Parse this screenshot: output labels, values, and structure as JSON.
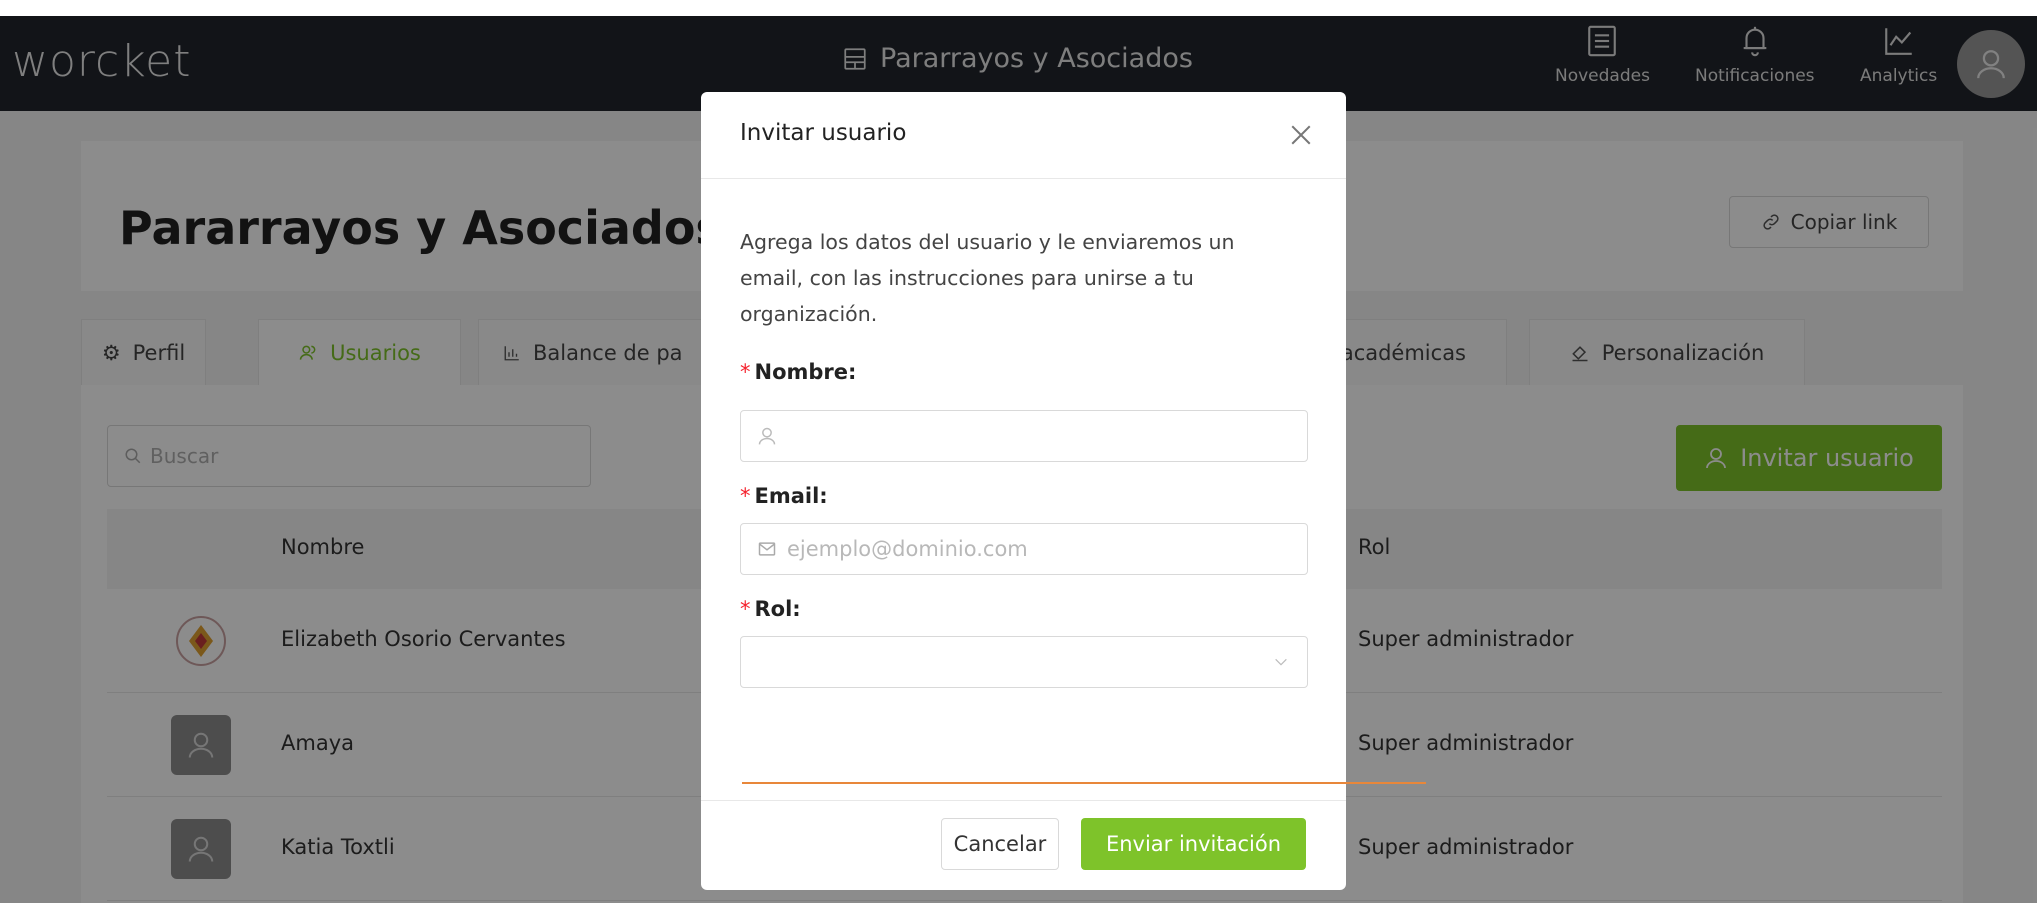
{
  "topbar": {
    "logo": "worcket",
    "org_name": "Pararrayos y Asociados",
    "items": [
      {
        "label": "Novedades",
        "icon": "list-icon"
      },
      {
        "label": "Notificaciones",
        "icon": "bell-icon"
      },
      {
        "label": "Analytics",
        "icon": "chart-line-icon"
      }
    ],
    "avatar_icon": "user-icon"
  },
  "header": {
    "title": "Pararrayos y Asociados",
    "copy_link_label": "Copiar link"
  },
  "tabs": [
    {
      "label": "Perfil",
      "icon": "gear-icon"
    },
    {
      "label": "Usuarios",
      "icon": "users-icon",
      "active": true
    },
    {
      "label": "Balance de pa",
      "icon": "bar-chart-icon"
    },
    {
      "label": "s académicas",
      "icon": ""
    },
    {
      "label": "Personalización",
      "icon": "paint-icon"
    }
  ],
  "users": {
    "search_placeholder": "Buscar",
    "invite_label": "Invitar usuario",
    "columns": {
      "name": "Nombre",
      "rol": "Rol"
    },
    "rows": [
      {
        "name": "Elizabeth Osorio Cervantes",
        "rol": "Super administrador"
      },
      {
        "name": "Amaya",
        "rol": "Super administrador"
      },
      {
        "name": "Katia Toxtli",
        "rol": "Super administrador"
      }
    ]
  },
  "modal": {
    "title": "Invitar usuario",
    "description": "Agrega los datos del usuario y le enviaremos un email, con las instrucciones para unirse a tu organización.",
    "required_mark": "*",
    "fields": {
      "name_label": "Nombre",
      "name_placeholder": "",
      "email_label": "Email",
      "email_placeholder": "ejemplo@dominio.com",
      "rol_label": "Rol",
      "rol_value": ""
    },
    "colon": ":",
    "cancel_label": "Cancelar",
    "submit_label": "Enviar invitación"
  },
  "colors": {
    "accent": "#7ec32a",
    "topbar": "#22262c",
    "required": "#f5222d",
    "annotation_line": "#e8873a"
  }
}
